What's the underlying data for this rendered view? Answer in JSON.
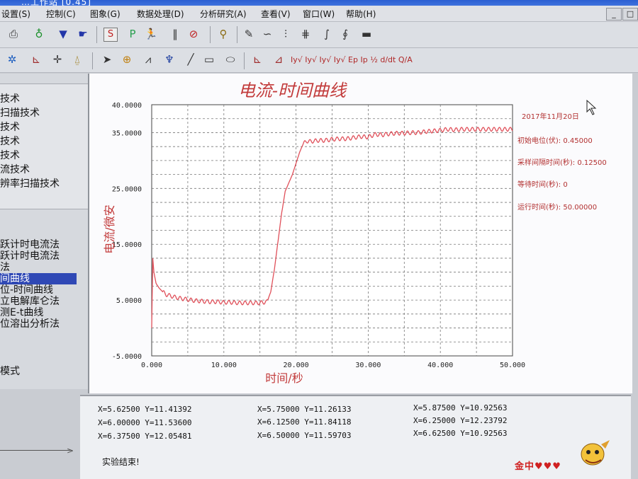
{
  "window": {
    "title": "…工作站  [0.45]"
  },
  "menu": [
    "设置(S)",
    "控制(C)",
    "图象(G)",
    "数据处理(D)",
    "分析研究(A)",
    "查看(V)",
    "窗口(W)",
    "帮助(H)"
  ],
  "window_buttons": [
    "_",
    "□"
  ],
  "toolbar1": {
    "icons": [
      "printer-icon",
      "electrode-icon",
      "chip-icon",
      "handshake-icon",
      "s-box-icon",
      "p-box-icon",
      "run-icon",
      "pause-icon",
      "stop-icon",
      "wrench-icon",
      "pen-icon",
      "curve-icon",
      "filter-icon",
      "resolution-icon",
      "integral-icon",
      "semi-integral-icon",
      "lcd-icon"
    ],
    "labels": {
      "s": "S",
      "p": "P"
    }
  },
  "toolbar2": {
    "icons": [
      "gear-icon",
      "axis-icon",
      "cross-icon",
      "peak-icon",
      "pointer-icon",
      "zoom-icon",
      "baseline-icon",
      "palette-icon",
      "line-icon",
      "rect-icon",
      "ellipse-icon",
      "deriv-icon",
      "trace-icon"
    ],
    "tools_text": "Iy√ Iy√ Iy√ Iy√ Ep Ip  ½  d/dt  Q/A"
  },
  "techniques": [
    "技术",
    "扫描技术",
    "技术",
    "技术",
    "技术",
    "流技术",
    "辨率扫描技术"
  ],
  "methods": [
    "跃计时电流法",
    "跃计时电流法",
    "法",
    "间曲线",
    "位-时间曲线",
    "立电解库仑法",
    "测E-t曲线",
    "位溶出分析法"
  ],
  "selected_method_index": 3,
  "mode_label": "模式",
  "info": {
    "date": "2017年11月20日",
    "init_potential": "初始电位(伏): 0.45000",
    "sample_interval": "采样间隔时间(秒): 0.12500",
    "wait_time": "等待时间(秒): 0",
    "run_time": "运行时间(秒): 50.00000"
  },
  "output": {
    "rows": [
      [
        "X=5.62500   Y=11.41392",
        "X=5.75000   Y=11.26133",
        "X=5.87500   Y=10.92563"
      ],
      [
        "X=6.00000   Y=11.53600",
        "X=6.12500   Y=11.84118",
        "X=6.25000   Y=12.23792"
      ],
      [
        "X=6.37500   Y=12.05481",
        "X=6.50000   Y=11.59703",
        "X=6.62500   Y=10.92563"
      ]
    ],
    "done": "实验结束!"
  },
  "logo": {
    "text": "金中♥♥♥"
  },
  "chart_data": {
    "type": "line",
    "title": "电流-时间曲线",
    "xlabel": "时间/秒",
    "ylabel": "电流/微安",
    "xlim": [
      0,
      50
    ],
    "ylim": [
      -5,
      40
    ],
    "xticks": [
      "0.000",
      "10.000",
      "20.000",
      "30.000",
      "40.000",
      "50.000"
    ],
    "yticks": [
      "40.0000",
      "35.0000",
      "25.0000",
      "15.0000",
      "5.0000",
      "-5.0000"
    ],
    "ytick_values": [
      40,
      35,
      25,
      15,
      5,
      -5
    ],
    "grid": true,
    "color": "#e0505a",
    "x": [
      0,
      0.15,
      0.3,
      0.6,
      1,
      1.5,
      2,
      3,
      4,
      5,
      6,
      7,
      8,
      9,
      10,
      11,
      12,
      13,
      14,
      15,
      16,
      16.5,
      17,
      17.5,
      18,
      18.5,
      19,
      19.5,
      20,
      20.5,
      21,
      21.5,
      22,
      22.5,
      23,
      24,
      25,
      26,
      27,
      28,
      29,
      30,
      31,
      32,
      33,
      34,
      35,
      36,
      37,
      38,
      39,
      40,
      41,
      42,
      43,
      44,
      45,
      46,
      47,
      48,
      49,
      50
    ],
    "y": [
      0,
      12.5,
      10,
      8,
      7.2,
      6.5,
      6.0,
      5.6,
      5.3,
      5.1,
      4.9,
      4.8,
      4.7,
      4.7,
      4.6,
      4.6,
      4.5,
      4.5,
      4.5,
      4.5,
      4.7,
      6.5,
      10.5,
      15.5,
      20.5,
      24.5,
      26.0,
      27.5,
      29.5,
      31.5,
      33.0,
      33.5,
      33.4,
      33.5,
      33.6,
      33.6,
      33.8,
      33.9,
      33.9,
      34.1,
      34.3,
      34.2,
      34.7,
      34.6,
      34.8,
      34.9,
      34.9,
      35.0,
      35.0,
      35.2,
      35.3,
      35.4,
      35.6,
      35.5,
      35.6,
      35.6,
      35.6,
      35.6,
      35.6,
      35.6,
      35.6,
      35.6
    ]
  }
}
